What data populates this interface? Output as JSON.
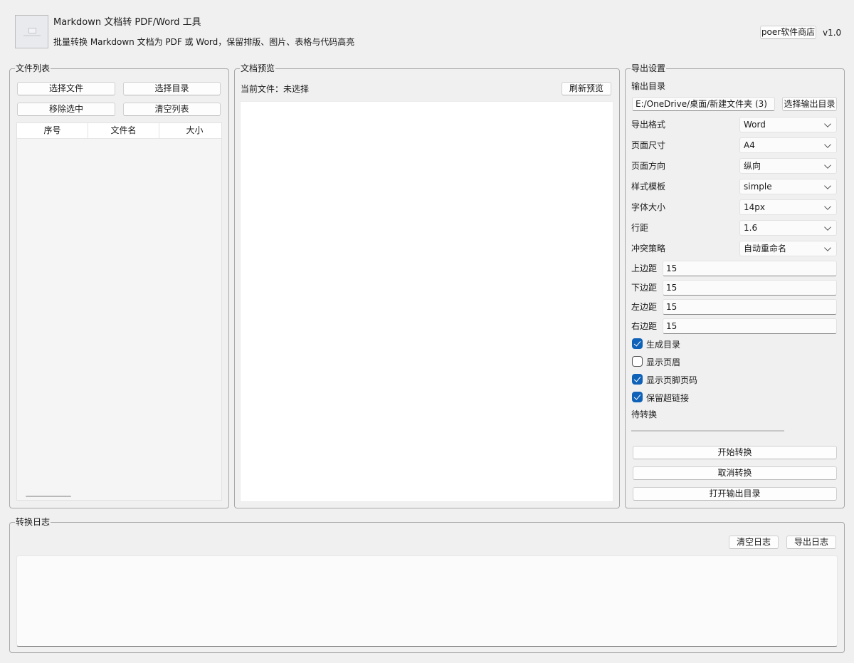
{
  "header": {
    "title": "Markdown 文档转 PDF/Word 工具",
    "subtitle": "批量转换 Markdown 文档为 PDF 或 Word，保留排版、图片、表格与代码高亮",
    "store_button": "poer软件商店",
    "version": "v1.0"
  },
  "file_list": {
    "title": "文件列表",
    "select_files": "选择文件",
    "select_dir": "选择目录",
    "remove_selected": "移除选中",
    "clear_list": "清空列表",
    "columns": [
      "序号",
      "文件名",
      "大小"
    ]
  },
  "preview": {
    "title": "文档预览",
    "current_file": "当前文件：未选择",
    "refresh": "刷新预览"
  },
  "export": {
    "title": "导出设置",
    "output_dir_label": "输出目录",
    "output_dir_value": "E:/OneDrive/桌面/新建文件夹 (3)",
    "choose_output_dir": "选择输出目录",
    "combos": [
      {
        "label": "导出格式",
        "value": "Word"
      },
      {
        "label": "页面尺寸",
        "value": "A4"
      },
      {
        "label": "页面方向",
        "value": "纵向"
      },
      {
        "label": "样式模板",
        "value": "simple"
      },
      {
        "label": "字体大小",
        "value": "14px"
      },
      {
        "label": "行距",
        "value": "1.6"
      },
      {
        "label": "冲突策略",
        "value": "自动重命名"
      }
    ],
    "margins": [
      {
        "label": "上边距",
        "value": "15"
      },
      {
        "label": "下边距",
        "value": "15"
      },
      {
        "label": "左边距",
        "value": "15"
      },
      {
        "label": "右边距",
        "value": "15"
      }
    ],
    "checks": [
      {
        "label": "生成目录",
        "checked": true
      },
      {
        "label": "显示页眉",
        "checked": false
      },
      {
        "label": "显示页脚页码",
        "checked": true
      },
      {
        "label": "保留超链接",
        "checked": true
      }
    ],
    "status": "待转换",
    "progress": 0,
    "start": "开始转换",
    "cancel": "取消转换",
    "open_output": "打开输出目录"
  },
  "log": {
    "title": "转换日志",
    "clear": "清空日志",
    "export": "导出日志"
  },
  "colors": {
    "accent": "#0f62b8",
    "window_bg": "#f0f0f0"
  }
}
